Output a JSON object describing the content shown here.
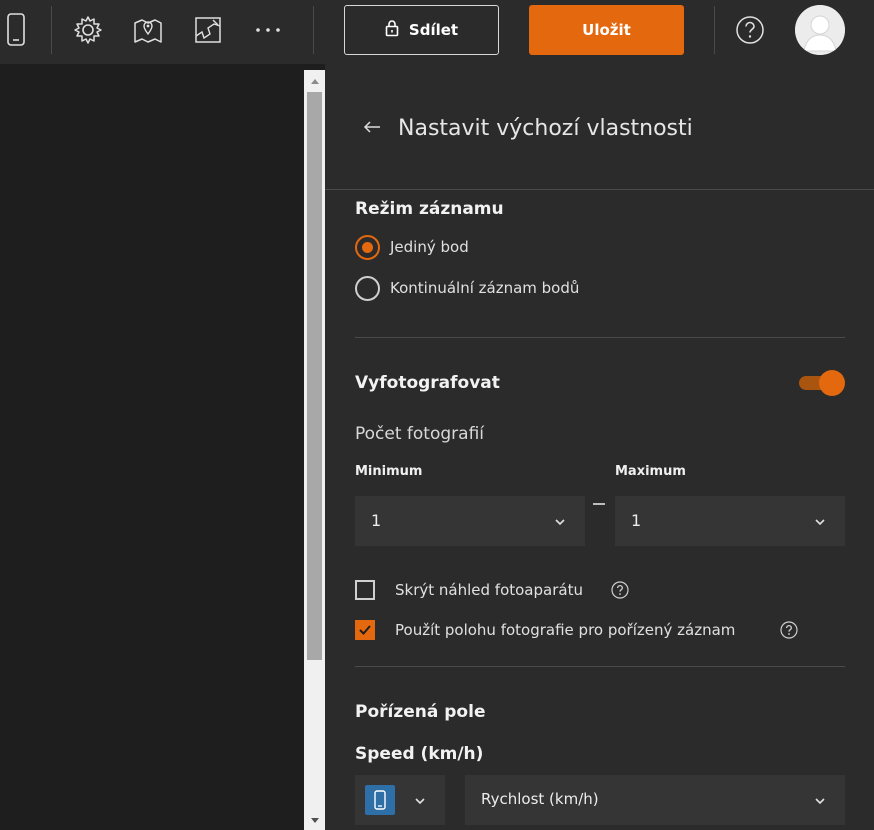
{
  "toolbar": {
    "share_label": "Sdílet",
    "save_label": "Uložit",
    "icons": [
      "mobile-device-icon",
      "gear-icon",
      "map-pin-icon",
      "map-edit-icon",
      "more-icon",
      "help-icon"
    ]
  },
  "panel": {
    "title": "Nastavit výchozí vlastnosti",
    "capture_mode": {
      "title": "Režim záznamu",
      "options": [
        {
          "label": "Jediný bod",
          "selected": true
        },
        {
          "label": "Kontinuální záznam bodů",
          "selected": false
        }
      ]
    },
    "photo": {
      "title": "Vyfotografovat",
      "enabled": true,
      "count_label": "Počet fotografií",
      "min_label": "Minimum",
      "max_label": "Maximum",
      "min_value": "1",
      "max_value": "1",
      "hide_preview_label": "Skrýt náhled fotoaparátu",
      "hide_preview_checked": false,
      "use_location_label": "Použít polohu fotografie pro pořízený záznam",
      "use_location_checked": true
    },
    "captured_fields": {
      "title": "Pořízená pole",
      "field_title": "Speed (km/h)",
      "source_icon": "mobile-device-icon",
      "field_value": "Rychlost (km/h)"
    }
  },
  "colors": {
    "accent": "#e3680e",
    "panel_bg": "#2b2b2b",
    "source_icon_bg": "#2f6fa8"
  }
}
